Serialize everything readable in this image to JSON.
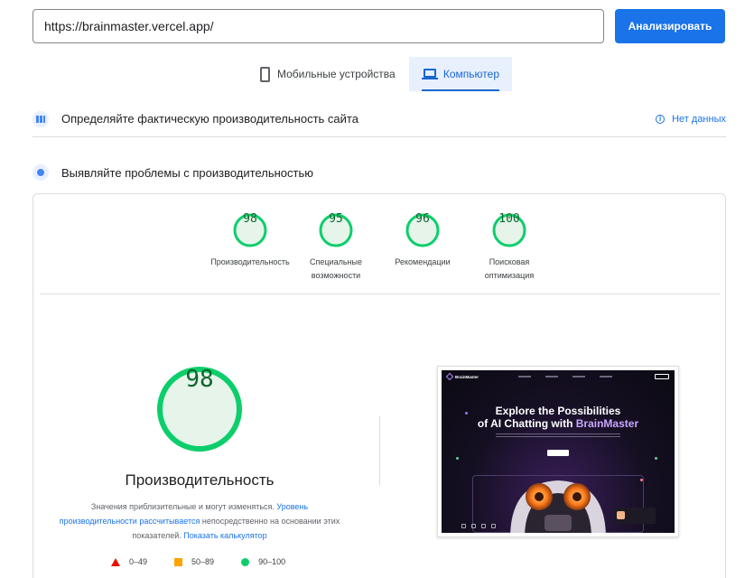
{
  "search": {
    "url": "https://brainmaster.vercel.app/",
    "analyze_label": "Анализировать"
  },
  "device_tabs": [
    {
      "label": "Мобильные устройства",
      "icon": "phone-icon",
      "active": false
    },
    {
      "label": "Компьютер",
      "icon": "laptop-icon",
      "active": true
    }
  ],
  "field_data": {
    "title": "Определяйте фактическую производительность сайта",
    "no_data": "Нет данных",
    "icon": "info-icon"
  },
  "lab_data": {
    "title": "Выявляйте проблемы с производительностью"
  },
  "scores": [
    {
      "value": 98,
      "label": "Производительность"
    },
    {
      "value": 95,
      "label": "Специальные возможности"
    },
    {
      "value": 96,
      "label": "Рекомендации"
    },
    {
      "value": 100,
      "label": "Поисковая оптимизация"
    }
  ],
  "performance": {
    "score": 98,
    "title": "Производительность",
    "desc_text": "Значения приблизительные и могут изменяться.",
    "desc_link1": "Уровень производительности рассчитывается",
    "desc_mid": "непосредственно на основании этих показателей.",
    "desc_link2": "Показать калькулятор"
  },
  "legend": [
    {
      "range": "0–49",
      "color": "#eb0f00",
      "shape": "triangle"
    },
    {
      "range": "50–89",
      "color": "#ffa400",
      "shape": "square"
    },
    {
      "range": "90–100",
      "color": "#0cce6b",
      "shape": "circle"
    }
  ],
  "screenshot": {
    "brand": "BrainMaster",
    "headline_line1": "Explore the Possibilities",
    "headline_line2_prefix": "of AI Chatting with ",
    "headline_brand": "BrainMaster"
  },
  "colors": {
    "accent": "#1a73e8",
    "pass": "#0cce6b",
    "pass_text": "#0d652d",
    "pass_bg": "#e6f4ea"
  }
}
